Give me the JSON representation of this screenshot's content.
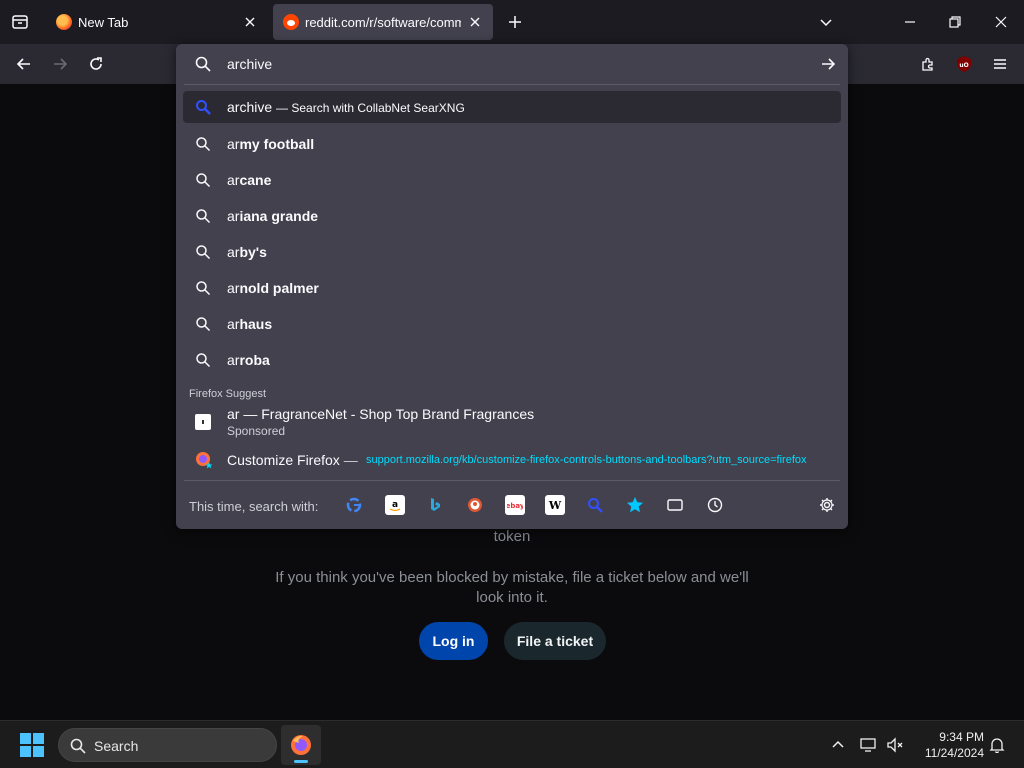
{
  "tabs": [
    {
      "title": "New Tab"
    },
    {
      "title": "reddit.com/r/software/comments"
    }
  ],
  "urlbar": {
    "value": "archive",
    "heuristic": {
      "query": "archive",
      "engine_text": "— Search with CollabNet SearXNG"
    },
    "suggestions": [
      {
        "prefix": "ar",
        "rest": "my football"
      },
      {
        "prefix": "ar",
        "rest": "cane"
      },
      {
        "prefix": "ar",
        "rest": "iana grande"
      },
      {
        "prefix": "ar",
        "rest": "by's"
      },
      {
        "prefix": "ar",
        "rest": "nold palmer"
      },
      {
        "prefix": "ar",
        "rest": "haus"
      },
      {
        "prefix": "ar",
        "rest": "roba"
      }
    ],
    "group_label": "Firefox Suggest",
    "sponsored": {
      "title": "ar — FragranceNet - Shop Top Brand Fragrances",
      "label": "Sponsored"
    },
    "tip": {
      "title": "Customize Firefox",
      "sep": "—",
      "url": "support.mozilla.org/kb/customize-firefox-controls-buttons-and-toolbars?utm_source=firefox"
    },
    "oneoff_label": "This time, search with:",
    "engines": [
      "google-icon",
      "amazon-icon",
      "bing-icon",
      "duckduckgo-icon",
      "ebay-icon",
      "wikipedia-icon",
      "searxng-icon",
      "bookmarks-icon",
      "tabs-icon",
      "history-icon"
    ]
  },
  "page": {
    "token_text": "token",
    "blocked_text": "If you think you've been blocked by mistake, file a ticket below and we'll look into it.",
    "login_label": "Log in",
    "ticket_label": "File a ticket"
  },
  "taskbar": {
    "search_label": "Search",
    "time": "9:34 PM",
    "date": "11/24/2024"
  },
  "colors": {
    "accent_link": "#00ddff",
    "login_btn": "#0045ac",
    "windows_accent": "#4cc2ff"
  }
}
